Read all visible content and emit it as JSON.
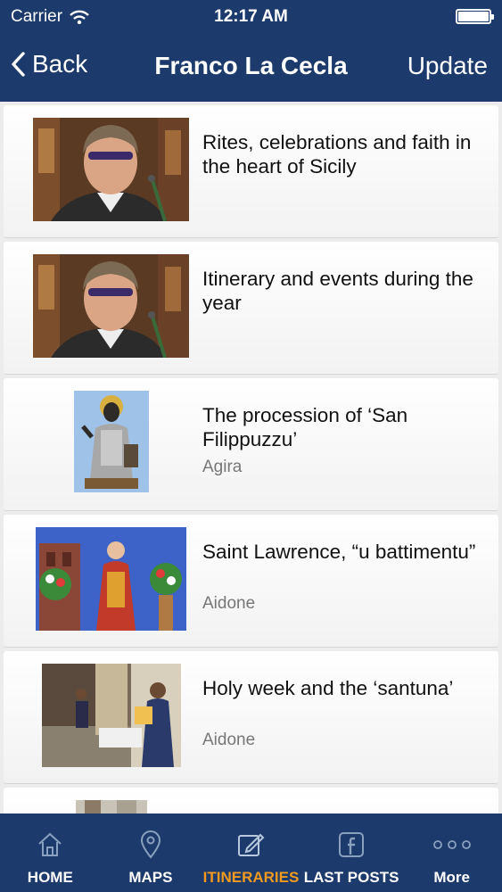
{
  "status_bar": {
    "carrier": "Carrier",
    "time": "12:17 AM"
  },
  "nav": {
    "back_label": "Back",
    "title": "Franco La Cecla",
    "update_label": "Update"
  },
  "items": [
    {
      "title": "Rites, celebrations and faith in the heart of Sicily",
      "subtitle": ""
    },
    {
      "title": "Itinerary and events during the year",
      "subtitle": ""
    },
    {
      "title": "The procession of ‘San Filippuzzu’",
      "subtitle": "Agira"
    },
    {
      "title": "Saint Lawrence, “u battimentu”",
      "subtitle": "Aidone"
    },
    {
      "title": "Holy week and the ‘santuna’",
      "subtitle": "Aidone"
    }
  ],
  "tabs": [
    {
      "label": "HOME",
      "icon": "home-icon",
      "active": false
    },
    {
      "label": "MAPS",
      "icon": "map-pin-icon",
      "active": false
    },
    {
      "label": "ITINERARIES",
      "icon": "itinerary-icon",
      "active": true
    },
    {
      "label": "LAST POSTS",
      "icon": "facebook-icon",
      "active": false
    },
    {
      "label": "More",
      "icon": "more-icon",
      "active": false
    }
  ],
  "colors": {
    "bar_background": "#1c3a6b",
    "active_tab": "#f39a1e",
    "label": "#ffffff"
  }
}
